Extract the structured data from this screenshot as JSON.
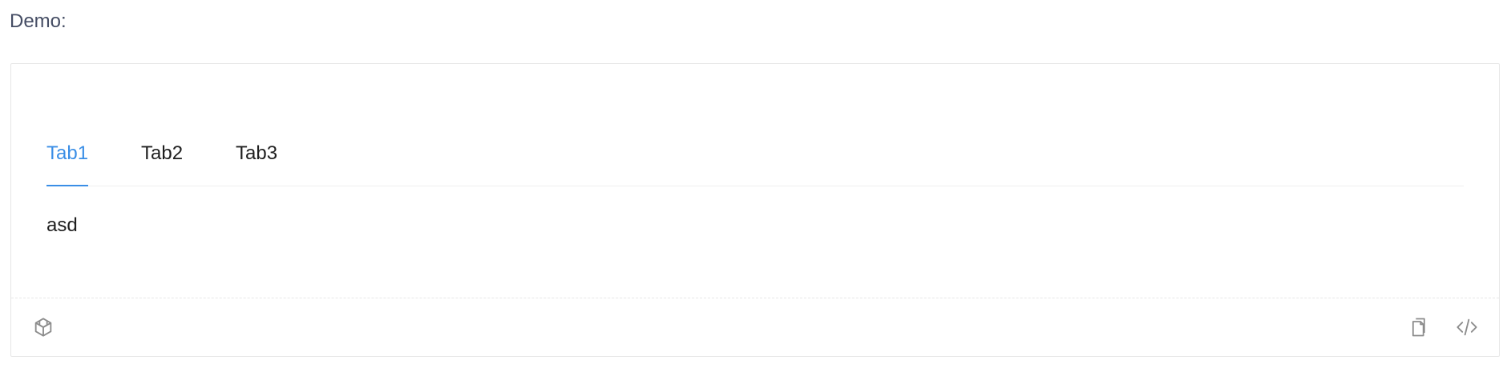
{
  "header": {
    "label": "Demo:"
  },
  "demo": {
    "tabs": [
      {
        "label": "Tab1",
        "active": true
      },
      {
        "label": "Tab2",
        "active": false
      },
      {
        "label": "Tab3",
        "active": false
      }
    ],
    "content": "asd"
  },
  "actions": {
    "left": [
      {
        "icon": "codesandbox-icon"
      }
    ],
    "right": [
      {
        "icon": "copy-icon"
      },
      {
        "icon": "code-icon"
      }
    ]
  },
  "colors": {
    "accent": "#3a8ee6",
    "border": "#e6e6e6",
    "text": "#1f1f1f",
    "muted_icon": "#8c8c8c"
  }
}
